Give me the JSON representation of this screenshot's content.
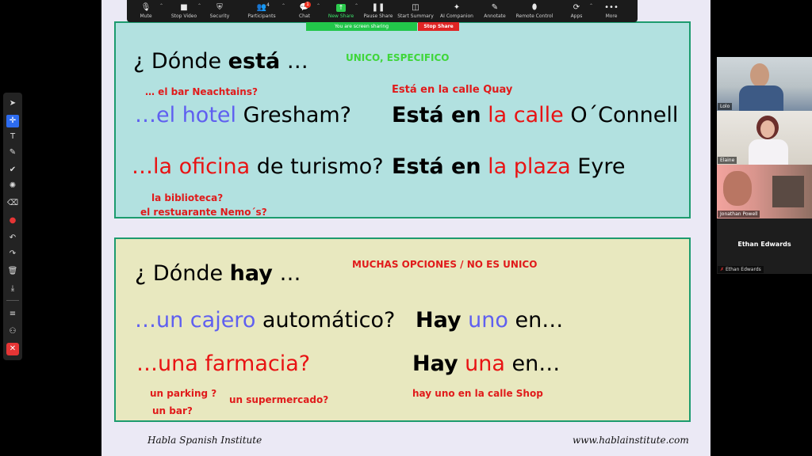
{
  "toolbar": {
    "items": [
      {
        "label": "Mute",
        "icon": "microphone-icon",
        "glyph": "🎙",
        "caret": true
      },
      {
        "label": "Stop Video",
        "icon": "video-camera-icon",
        "glyph": "■",
        "caret": true
      },
      {
        "label": "Security",
        "icon": "shield-icon",
        "glyph": "⛨",
        "caret": false
      },
      {
        "label": "Participants",
        "icon": "participants-icon",
        "glyph": "👥",
        "count": "4",
        "caret": true
      },
      {
        "label": "Chat",
        "icon": "chat-icon",
        "glyph": "💬",
        "badge": "1",
        "caret": true
      },
      {
        "label": "New Share",
        "icon": "share-arrow-icon",
        "glyph": "↑",
        "caret": true
      },
      {
        "label": "Pause Share",
        "icon": "pause-icon",
        "glyph": "❚❚",
        "caret": false
      },
      {
        "label": "Start Summary",
        "icon": "summary-icon",
        "glyph": "◫",
        "caret": false
      },
      {
        "label": "AI Companion",
        "icon": "sparkle-icon",
        "glyph": "✦",
        "caret": false
      },
      {
        "label": "Annotate",
        "icon": "pen-icon",
        "glyph": "✎",
        "caret": false
      },
      {
        "label": "Remote Control",
        "icon": "mouse-icon",
        "glyph": "⬮",
        "caret": false
      },
      {
        "label": "Apps",
        "icon": "apps-icon",
        "glyph": "⟳",
        "caret": true
      },
      {
        "label": "More",
        "icon": "more-dots-icon",
        "glyph": "•••",
        "caret": false
      }
    ]
  },
  "share_banner": {
    "text": "You are screen sharing",
    "stop_label": "Stop Share"
  },
  "slide": {
    "box1": {
      "question_prefix": "¿ Dónde ",
      "question_bold": "está",
      "question_suffix": " …",
      "tag": "UNICO, ESPECIFICO",
      "hint_bar": "… el bar Neachtains?",
      "hint_street": "Está en la calle Quay",
      "row1_left_blue": "…el hotel",
      "row1_left_black": " Gresham?",
      "row1_right_bold": "Está en",
      "row1_right_red": " la calle",
      "row1_right_black": " O´Connell",
      "row2_left_red": "…la oficina",
      "row2_left_black": " de turismo?",
      "row2_right_bold": "Está en",
      "row2_right_red": " la plaza",
      "row2_right_black": " Eyre",
      "hint_library": "la biblioteca?",
      "hint_restaurant": "el restuarante Nemo´s?"
    },
    "box2": {
      "question_prefix": "¿ Dónde ",
      "question_bold": "hay",
      "question_suffix": " …",
      "tag": "MUCHAS OPCIONES / NO ES UNICO",
      "row1_left_blue": "…un cajero",
      "row1_left_black": " automático?",
      "row1_right_bold": "Hay",
      "row1_right_blue": " uno",
      "row1_right_black": " en…",
      "row2_left_red": "…una farmacia?",
      "row2_right_bold": "Hay",
      "row2_right_red": " una",
      "row2_right_black": " en…",
      "hint_parking": "un parking ?",
      "hint_bar": "un bar?",
      "hint_supermarket": "un supermercado?",
      "hint_shop": "hay uno en la calle Shop"
    },
    "footer_left": "Habla Spanish Institute",
    "footer_right": "www.hablainstitute.com"
  },
  "annotation_tools": [
    {
      "icon": "select-arrow-icon",
      "glyph": "➤"
    },
    {
      "icon": "spotlight-icon",
      "glyph": "✛"
    },
    {
      "icon": "text-icon",
      "glyph": "T"
    },
    {
      "icon": "draw-pen-icon",
      "glyph": "✎"
    },
    {
      "icon": "stamp-check-icon",
      "glyph": "✔"
    },
    {
      "icon": "vanishing-pen-icon",
      "glyph": "✺"
    },
    {
      "icon": "eraser-icon",
      "glyph": "⌫"
    },
    {
      "icon": "color-red-icon",
      "glyph": "●"
    },
    {
      "icon": "undo-icon",
      "glyph": "↶"
    },
    {
      "icon": "redo-icon",
      "glyph": "↷"
    },
    {
      "icon": "trash-icon",
      "glyph": "🗑"
    },
    {
      "icon": "save-icon",
      "glyph": "⤓"
    },
    {
      "icon": "menu-icon",
      "glyph": "≡"
    },
    {
      "icon": "participant-pen-icon",
      "glyph": "⚇"
    },
    {
      "icon": "close-icon",
      "glyph": "✕"
    }
  ],
  "participants": [
    {
      "name": "Lolo"
    },
    {
      "name": "Elaine"
    },
    {
      "name": "Jonathan Powell"
    },
    {
      "name": "Ethan Edwards"
    }
  ],
  "active_name": "Ethan Edwards",
  "colors": {
    "accent_green": "#2ccb4d",
    "stop_red": "#e02424",
    "slide_border": "#1c9b6e"
  }
}
